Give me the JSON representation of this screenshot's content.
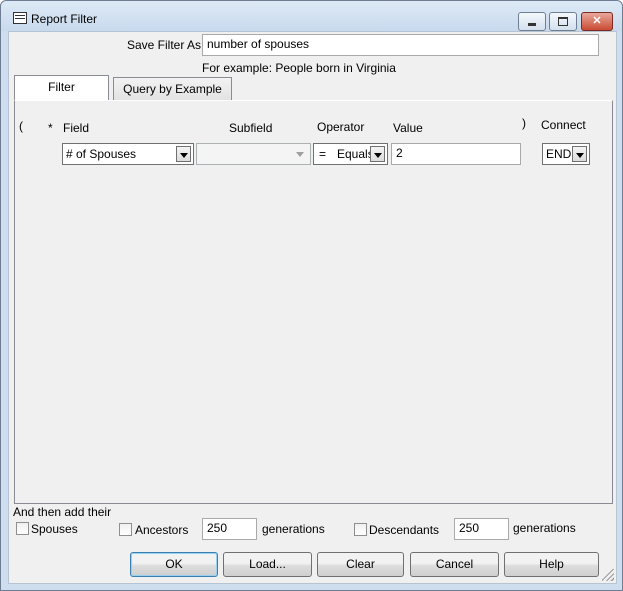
{
  "window": {
    "title": "Report Filter"
  },
  "save_filter": {
    "label": "Save Filter As",
    "value": "number of spouses",
    "example": "For example: People born in Virginia"
  },
  "tabs": [
    {
      "label": "Filter",
      "active": true
    },
    {
      "label": "Query by Example",
      "active": false
    }
  ],
  "columns": {
    "open_paren": "(",
    "star": "*",
    "field": "Field",
    "subfield": "Subfield",
    "operator": "Operator",
    "value": "Value",
    "close_paren": ")",
    "connect": "Connect"
  },
  "row": {
    "field": "# of Spouses",
    "subfield": "",
    "operator_symbol": "=",
    "operator": "Equals",
    "value": "2",
    "connect": "END"
  },
  "add": {
    "heading": "And then add their",
    "spouses_label": "Spouses",
    "ancestors_label": "Ancestors",
    "ancestors_generations": "250",
    "generations_label": "generations",
    "descendants_label": "Descendants",
    "descendants_generations": "250"
  },
  "buttons": {
    "ok": "OK",
    "load": "Load...",
    "clear": "Clear",
    "cancel": "Cancel",
    "help": "Help"
  }
}
